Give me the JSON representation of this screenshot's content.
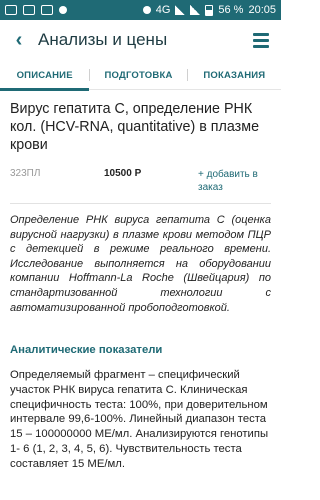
{
  "statusbar": {
    "network": "4G",
    "battery_percent": "56 %",
    "time": "20:05"
  },
  "appbar": {
    "title": "Анализы и цены",
    "back_icon": "chevron-left-icon",
    "menu_icon": "hamburger-menu-icon"
  },
  "tabs": [
    {
      "label": "ОПИСАНИЕ",
      "active": true
    },
    {
      "label": "ПОДГОТОВКА",
      "active": false
    },
    {
      "label": "ПОКАЗАНИЯ",
      "active": false
    }
  ],
  "test": {
    "title": "Вирус гепатита С, определение РНК кол. (HCV-RNA, quantitative) в плазме крови",
    "code": "323ПЛ",
    "price": "10500 Р",
    "add_to_order": "+ добавить в заказ",
    "description": "Определение РНК вируса гепатита С (оценка вирусной нагрузки) в плазме крови методом ПЦР с детекцией в режиме реального времени. Исследование выполняется на оборудовании компании Hoffmann-La Roche (Швейцария) по стандартизованной технологии с автоматизированной пробоподготовкой.",
    "section_heading": "Аналитические показатели",
    "section_text": "Определяемый фрагмент – специфический участок РНК вируса гепатита С. Клиническая специфичность теста: 100%, при доверительном интервале 99,6-100%. Линейный диапазон теста 15 – 100000000 МЕ/мл. Анализируются генотипы 1- 6 (1, 2, 3, 4, 5, 6). Чувствительность теста составляет 15 МЕ/мл."
  },
  "colors": {
    "accent": "#1f6a75",
    "statusbar": "#1f6a75"
  }
}
